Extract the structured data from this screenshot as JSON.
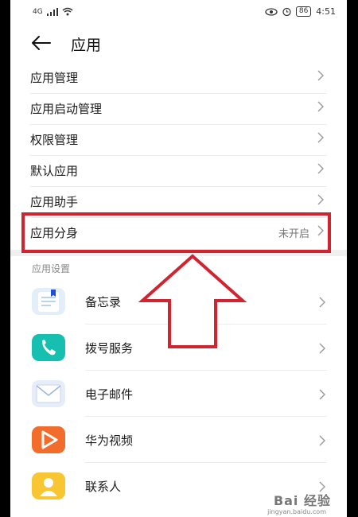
{
  "status_bar": {
    "network": "4G",
    "battery": "86",
    "time": "4:51"
  },
  "header": {
    "title": "应用"
  },
  "menu": [
    {
      "label": "应用管理"
    },
    {
      "label": "应用启动管理"
    },
    {
      "label": "权限管理"
    },
    {
      "label": "默认应用"
    },
    {
      "label": "应用助手"
    },
    {
      "label": "应用分身",
      "status": "未开启"
    }
  ],
  "section": {
    "title": "应用设置"
  },
  "apps": [
    {
      "label": "备忘录",
      "icon": "memo-icon",
      "color": "#d7e8f6"
    },
    {
      "label": "拨号服务",
      "icon": "phone-icon",
      "color": "#16bfb0"
    },
    {
      "label": "电子邮件",
      "icon": "email-icon",
      "color": "#dfe8f5"
    },
    {
      "label": "华为视频",
      "icon": "video-icon",
      "color": "#f26c2b"
    },
    {
      "label": "联系人",
      "icon": "contacts-icon",
      "color": "#f8c633"
    }
  ],
  "annotation": {
    "box_color": "#d12431"
  },
  "watermark": {
    "text": "Bai 经验",
    "sub": "jingyan.baidu.com"
  }
}
